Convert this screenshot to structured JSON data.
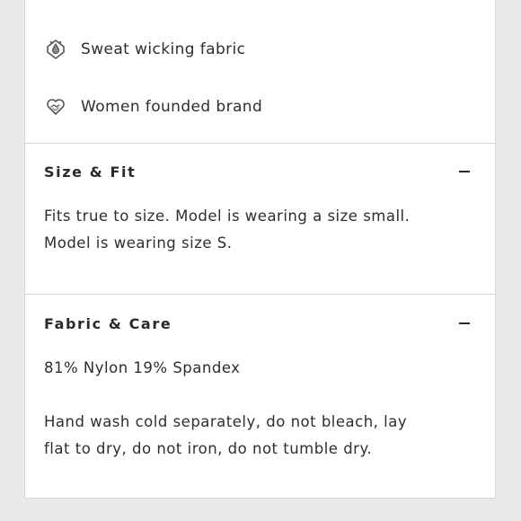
{
  "features": [
    {
      "icon": "water-drop-badge-icon",
      "label": "Sweat wicking fabric"
    },
    {
      "icon": "heart-handshake-icon",
      "label": "Women founded brand"
    }
  ],
  "sections": {
    "size_fit": {
      "title": "Size & Fit",
      "toggle": "collapse",
      "lines": [
        "Fits true to size. Model is wearing a size small.",
        "Model is wearing size S."
      ]
    },
    "fabric_care": {
      "title": "Fabric & Care",
      "toggle": "collapse",
      "composition": "81% Nylon 19% Spandex",
      "care_lines": [
        "Hand wash cold separately, do not bleach, lay",
        "flat to dry, do not iron, do not tumble dry."
      ]
    }
  },
  "colors": {
    "background": "#e9e9e9",
    "panel": "#ffffff",
    "divider": "#d6d6d6",
    "text": "#2e2e2e"
  }
}
